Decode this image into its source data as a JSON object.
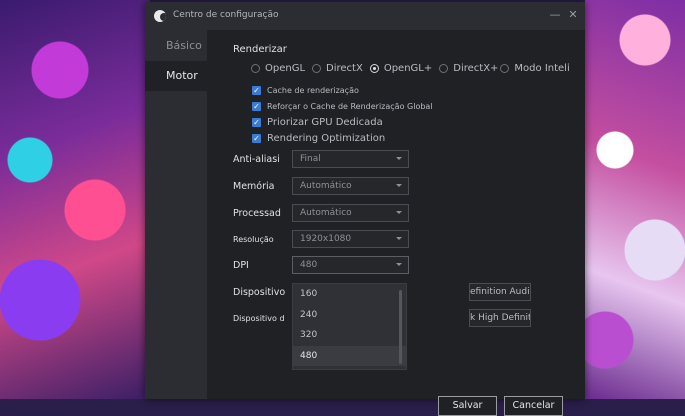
{
  "window": {
    "title": "Centro de configuração"
  },
  "sidebar": {
    "items": [
      {
        "label": "Básico"
      },
      {
        "label": "Motor"
      }
    ]
  },
  "renderer": {
    "title": "Renderizar",
    "options": [
      {
        "label": "OpenGL",
        "selected": false
      },
      {
        "label": "DirectX",
        "selected": false
      },
      {
        "label": "OpenGL+",
        "selected": true
      },
      {
        "label": "DirectX+",
        "selected": false
      },
      {
        "label": "Modo Inteli",
        "selected": false
      }
    ],
    "checks": [
      {
        "label": "Cache de renderização",
        "checked": true
      },
      {
        "label": "Reforçar o Cache de Renderização Global",
        "checked": true
      },
      {
        "label": "Priorizar GPU Dedicada",
        "checked": true
      },
      {
        "label": "Rendering Optimization",
        "checked": true
      }
    ]
  },
  "settings": {
    "anti_alias": {
      "label": "Anti-aliasi",
      "value": "Final"
    },
    "memory": {
      "label": "Memória",
      "value": "Automático"
    },
    "processor": {
      "label": "Processad",
      "value": "Automático"
    },
    "resolution": {
      "label": "Resolução",
      "value": "1920x1080"
    },
    "dpi": {
      "label": "DPI",
      "value": "480",
      "options": [
        "160",
        "240",
        "320",
        "480"
      ]
    },
    "device": {
      "label": "Dispositivo",
      "value": "efinition Audio"
    },
    "device2": {
      "label": "Dispositivo d",
      "value": "k High Definiti"
    }
  },
  "buttons": {
    "save": "Salvar",
    "cancel": "Cancelar"
  },
  "colors": {
    "accent": "#3a7bd6",
    "dialog_bg": "#2b2d33",
    "content_bg": "#1f2125"
  }
}
